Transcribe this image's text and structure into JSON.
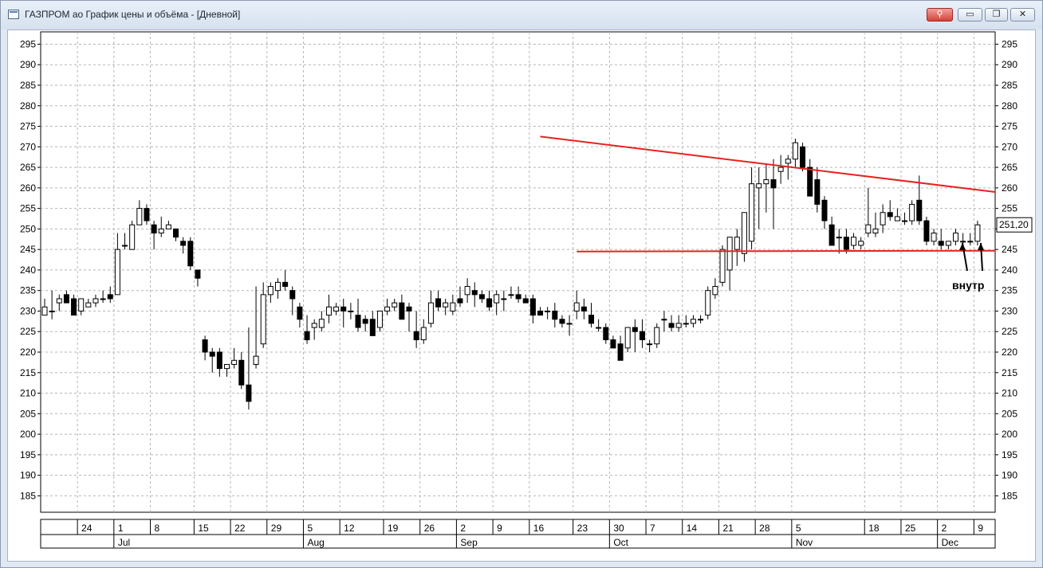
{
  "window": {
    "title": "ГАЗПРОМ ао График цены и объёма - [Дневной]",
    "buttons": {
      "minimize": "▭",
      "restore": "❐",
      "close": "✕",
      "link": "⚲"
    }
  },
  "colors": {
    "accent_line": "#e8221f",
    "grid": "#b5b5b5",
    "frame": "#000000"
  },
  "chart_data": {
    "type": "candlestick",
    "title": "",
    "ylim": [
      181,
      298
    ],
    "y_ticks": [
      185,
      190,
      195,
      200,
      205,
      210,
      215,
      220,
      225,
      230,
      235,
      240,
      245,
      250,
      255,
      260,
      265,
      270,
      275,
      280,
      285,
      290,
      295
    ],
    "last_price_label": "251,20",
    "x_day_labels": [
      "24",
      "1",
      "8",
      "15",
      "22",
      "29",
      "5",
      "12",
      "19",
      "26",
      "2",
      "9",
      "16",
      "23",
      "30",
      "7",
      "14",
      "21",
      "28",
      "5",
      "18",
      "25",
      "2",
      "9"
    ],
    "x_month_labels": [
      "Jul",
      "Aug",
      "Sep",
      "Oct",
      "Nov",
      "Dec"
    ],
    "annotation": "внутр",
    "trendlines": [
      {
        "from": [
          68,
          272.5
        ],
        "to": [
          123,
          259.0
        ]
      },
      {
        "from": [
          73,
          244.5
        ],
        "to": [
          123,
          244.7
        ]
      }
    ],
    "candles": [
      [
        229,
        233,
        229,
        231
      ],
      [
        230,
        235,
        228,
        230
      ],
      [
        232,
        234,
        230,
        233
      ],
      [
        234,
        235,
        232,
        232
      ],
      [
        233,
        234,
        229,
        229
      ],
      [
        230,
        233,
        229,
        233
      ],
      [
        231,
        233,
        231,
        232
      ],
      [
        232,
        234,
        231,
        233
      ],
      [
        233,
        235,
        232,
        233
      ],
      [
        234,
        236,
        232,
        233
      ],
      [
        234,
        249,
        234,
        245
      ],
      [
        246,
        249,
        245,
        246
      ],
      [
        245,
        252,
        245,
        251
      ],
      [
        251,
        257,
        251,
        255
      ],
      [
        255,
        256,
        251,
        252
      ],
      [
        251,
        252,
        245,
        249
      ],
      [
        249,
        253,
        248,
        250
      ],
      [
        250,
        252,
        250,
        251
      ],
      [
        250,
        250,
        247,
        248
      ],
      [
        247,
        248,
        244,
        246
      ],
      [
        247,
        248,
        240,
        241
      ],
      [
        240,
        240,
        236,
        238
      ],
      [
        223,
        224,
        218,
        220
      ],
      [
        220,
        221,
        215,
        219
      ],
      [
        220,
        221,
        214,
        216
      ],
      [
        216,
        217,
        214,
        217
      ],
      [
        217,
        221,
        216,
        218
      ],
      [
        218,
        220,
        211,
        212
      ],
      [
        212,
        226,
        206,
        208
      ],
      [
        217,
        236,
        216,
        219
      ],
      [
        222,
        237,
        221,
        234
      ],
      [
        234,
        237,
        232,
        236
      ],
      [
        235,
        238,
        233,
        237
      ],
      [
        237,
        240,
        235,
        236
      ],
      [
        235,
        236,
        229,
        233
      ],
      [
        231,
        232,
        226,
        228
      ],
      [
        225,
        229,
        222,
        223
      ],
      [
        226,
        228,
        223,
        227
      ],
      [
        226,
        230,
        225,
        228
      ],
      [
        229,
        234,
        227,
        231
      ],
      [
        230,
        232,
        229,
        231
      ],
      [
        231,
        233,
        226,
        230
      ],
      [
        230,
        232,
        228,
        230
      ],
      [
        229,
        233,
        225,
        226
      ],
      [
        228,
        229,
        225,
        227
      ],
      [
        228,
        230,
        224,
        224
      ],
      [
        226,
        230,
        225,
        230
      ],
      [
        230,
        233,
        229,
        231
      ],
      [
        231,
        233,
        230,
        232
      ],
      [
        232,
        234,
        229,
        228
      ],
      [
        231,
        232,
        225,
        230
      ],
      [
        225,
        230,
        221,
        223
      ],
      [
        223,
        228,
        222,
        226
      ],
      [
        227,
        235,
        226,
        232
      ],
      [
        233,
        235,
        230,
        231
      ],
      [
        231,
        233,
        229,
        232
      ],
      [
        230,
        234,
        229,
        232
      ],
      [
        233,
        236,
        231,
        232
      ],
      [
        234,
        238,
        232,
        236
      ],
      [
        235,
        237,
        231,
        234
      ],
      [
        234,
        235,
        232,
        233
      ],
      [
        233,
        235,
        230,
        231
      ],
      [
        232,
        235,
        229,
        234
      ],
      [
        233,
        235,
        230,
        233
      ],
      [
        234,
        236,
        233,
        234
      ],
      [
        234,
        236,
        232,
        233
      ],
      [
        233,
        234,
        232,
        232
      ],
      [
        233,
        234,
        227,
        229
      ],
      [
        230,
        231,
        229,
        229
      ],
      [
        230,
        231,
        228,
        230
      ],
      [
        230,
        232,
        226,
        228
      ],
      [
        228,
        229,
        226,
        227
      ],
      [
        227,
        229,
        224,
        227
      ],
      [
        230,
        235,
        228,
        232
      ],
      [
        231,
        233,
        228,
        230
      ],
      [
        229,
        232,
        226,
        227
      ],
      [
        226,
        228,
        225,
        226
      ],
      [
        226,
        227,
        222,
        223
      ],
      [
        223,
        224,
        221,
        221
      ],
      [
        222,
        224,
        220,
        218
      ],
      [
        221,
        226,
        220,
        226
      ],
      [
        226,
        228,
        220,
        225
      ],
      [
        225,
        228,
        221,
        223
      ],
      [
        222,
        223,
        220,
        222
      ],
      [
        222,
        227,
        221,
        226
      ],
      [
        228,
        230,
        225,
        228
      ],
      [
        227,
        229,
        225,
        226
      ],
      [
        226,
        229,
        225,
        227
      ],
      [
        227,
        229,
        226,
        227
      ],
      [
        227,
        229,
        226,
        228
      ],
      [
        228,
        229,
        227,
        228
      ],
      [
        229,
        236,
        228,
        235
      ],
      [
        234,
        238,
        233,
        236
      ],
      [
        237,
        246,
        236,
        245
      ],
      [
        240,
        248,
        235,
        248
      ],
      [
        245,
        250,
        241,
        248
      ],
      [
        244,
        253,
        242,
        254
      ],
      [
        247,
        265,
        245,
        261
      ],
      [
        260,
        265,
        250,
        261
      ],
      [
        261,
        266,
        254,
        262
      ],
      [
        262,
        267,
        250,
        260
      ],
      [
        264,
        268,
        261,
        265
      ],
      [
        266,
        268,
        262,
        267
      ],
      [
        267,
        272,
        265,
        271
      ],
      [
        270,
        271,
        264,
        265
      ],
      [
        265,
        267,
        259,
        258
      ],
      [
        262,
        265,
        254,
        256
      ],
      [
        257,
        258,
        250,
        252
      ],
      [
        251,
        253,
        246,
        246
      ],
      [
        248,
        250,
        244,
        248
      ],
      [
        248,
        250,
        244,
        245
      ],
      [
        246,
        249,
        245,
        248
      ],
      [
        246,
        248,
        245,
        247
      ],
      [
        249,
        260,
        248,
        251
      ],
      [
        249,
        254,
        248,
        250
      ],
      [
        251,
        256,
        249,
        254
      ],
      [
        254,
        257,
        252,
        253
      ],
      [
        252,
        255,
        252,
        253
      ],
      [
        252,
        254,
        251,
        252
      ],
      [
        252,
        257,
        251,
        256
      ],
      [
        257,
        263,
        251,
        252
      ],
      [
        252,
        253,
        246,
        247
      ],
      [
        247,
        250,
        246,
        249
      ],
      [
        247,
        250,
        245,
        246
      ],
      [
        246,
        247,
        245,
        247
      ],
      [
        247,
        250,
        246,
        249
      ],
      [
        247,
        249,
        246,
        247
      ],
      [
        247,
        249,
        246,
        247
      ],
      [
        247,
        252,
        246,
        251
      ]
    ]
  }
}
